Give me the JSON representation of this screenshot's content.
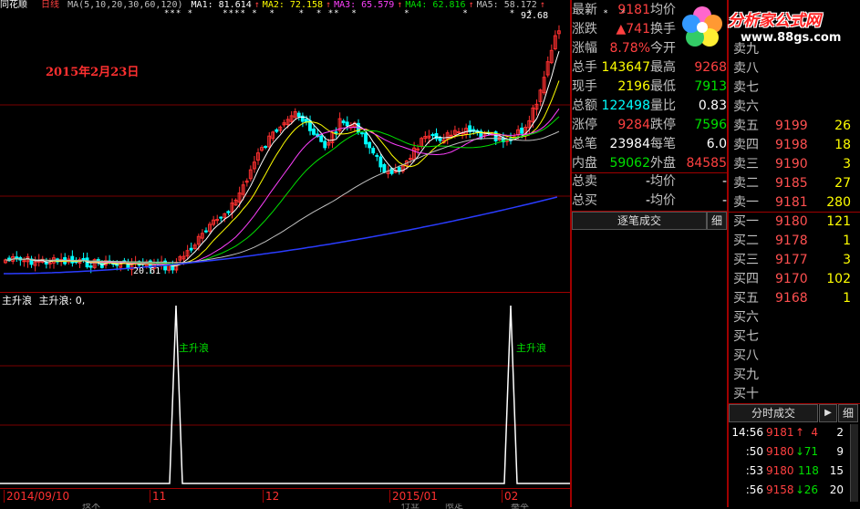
{
  "header": {
    "app_name": "同花顺",
    "period": "日线",
    "ma_params": "MA(5,10,20,30,60,120)",
    "ma": [
      {
        "label": "MA1:",
        "value": "81.614",
        "arrow": "↑",
        "color": "#ffffff"
      },
      {
        "label": "MA2:",
        "value": "72.158",
        "arrow": "↑",
        "color": "#ffff00"
      },
      {
        "label": "MA3:",
        "value": "65.579",
        "arrow": "↑",
        "color": "#ff40ff"
      },
      {
        "label": "MA4:",
        "value": "62.816",
        "arrow": "↑",
        "color": "#00e000"
      },
      {
        "label": "MA5:",
        "value": "58.172",
        "arrow": "↑",
        "color": "#c0c0c0"
      }
    ],
    "max_price_label": "92.68"
  },
  "chart": {
    "date_annotation": "2015年2月23日",
    "min_price_label": "20.61",
    "indicator_title": "主升浪",
    "indicator_value": "主升浪: 0,",
    "signal_label": "主升浪",
    "x_axis_labels": [
      "2014/09/10",
      "11",
      "12",
      "2015/01",
      "02"
    ],
    "bottom_tabs": [
      "技术",
      "行业",
      "限定",
      "基本"
    ]
  },
  "chart_data": {
    "type": "candlestick",
    "title": "",
    "xlabel": "",
    "ylabel": "",
    "x_axis_ticks": [
      "2014/09/10",
      "11",
      "12",
      "2015/01",
      "02"
    ],
    "price_labels": {
      "max": 92.68,
      "min": 20.61
    },
    "ma_series": [
      {
        "name": "MA1",
        "last": 81.614
      },
      {
        "name": "MA2",
        "last": 72.158
      },
      {
        "name": "MA3",
        "last": 65.579
      },
      {
        "name": "MA4",
        "last": 62.816
      },
      {
        "name": "MA5",
        "last": 58.172
      }
    ],
    "indicator": {
      "name": "主升浪",
      "current": 0,
      "signals_at": [
        "11",
        "02"
      ]
    }
  },
  "quote": {
    "rows": [
      {
        "l1": "最新",
        "v1": "9181",
        "v1c": "#ff4040",
        "l2": "均价",
        "v2": "",
        "v2c": "#ffffff"
      },
      {
        "l1": "涨跌",
        "v1": "▲741",
        "v1c": "#ff4040",
        "l2": "换手",
        "v2": "",
        "v2c": "#ffffff"
      },
      {
        "l1": "涨幅",
        "v1": "8.78%",
        "v1c": "#ff4040",
        "l2": "今开",
        "v2": "",
        "v2c": "#ffffff"
      },
      {
        "l1": "总手",
        "v1": "143647",
        "v1c": "#ffff00",
        "l2": "最高",
        "v2": "9268",
        "v2c": "#ff4040"
      },
      {
        "l1": "现手",
        "v1": "2196",
        "v1c": "#ffff00",
        "l2": "最低",
        "v2": "7913",
        "v2c": "#00e000"
      },
      {
        "l1": "总额",
        "v1": "122498",
        "v1c": "#00ffff",
        "l2": "量比",
        "v2": "0.83",
        "v2c": "#ffffff"
      },
      {
        "l1": "涨停",
        "v1": "9284",
        "v1c": "#ff4040",
        "l2": "跌停",
        "v2": "7596",
        "v2c": "#00e000"
      },
      {
        "l1": "总笔",
        "v1": "23984",
        "v1c": "#ffffff",
        "l2": "每笔",
        "v2": "6.0",
        "v2c": "#ffffff"
      },
      {
        "l1": "内盘",
        "v1": "59062",
        "v1c": "#00e000",
        "l2": "外盘",
        "v2": "84585",
        "v2c": "#ff4040"
      },
      {
        "l1": "总卖",
        "v1": "-",
        "v1c": "#ffffff",
        "l2": "均价",
        "v2": "-",
        "v2c": "#ffffff"
      },
      {
        "l1": "总买",
        "v1": "-",
        "v1c": "#ffffff",
        "l2": "均价",
        "v2": "-",
        "v2c": "#ffffff"
      }
    ],
    "trade_detail_tab": "逐笔成交",
    "detail_tab": "细"
  },
  "order_book": {
    "asks_partial": [
      "卖九",
      "卖八",
      "卖七",
      "卖六"
    ],
    "asks": [
      {
        "label": "卖五",
        "price": "9199",
        "vol": "26"
      },
      {
        "label": "卖四",
        "price": "9198",
        "vol": "18"
      },
      {
        "label": "卖三",
        "price": "9190",
        "vol": "3"
      },
      {
        "label": "卖二",
        "price": "9185",
        "vol": "27"
      },
      {
        "label": "卖一",
        "price": "9181",
        "vol": "280"
      }
    ],
    "bids": [
      {
        "label": "买一",
        "price": "9180",
        "vol": "121"
      },
      {
        "label": "买二",
        "price": "9178",
        "vol": "1"
      },
      {
        "label": "买三",
        "price": "9177",
        "vol": "3"
      },
      {
        "label": "买四",
        "price": "9170",
        "vol": "102"
      },
      {
        "label": "买五",
        "price": "9168",
        "vol": "1"
      }
    ],
    "bids_empty": [
      "买六",
      "买七",
      "买八",
      "买九",
      "买十"
    ]
  },
  "ticks": {
    "tab_label": "分时成交",
    "detail_tab": "细",
    "rows": [
      {
        "time": "14:56",
        "price": "9181",
        "arrow": "↑",
        "arrow_color": "#ff4040",
        "vol": "4",
        "n": "2"
      },
      {
        "time": ":50",
        "price": "9180",
        "arrow": "↓",
        "arrow_color": "#00e000",
        "vol": "71",
        "n": "9"
      },
      {
        "time": ":53",
        "price": "9180",
        "arrow": "",
        "arrow_color": "#00e000",
        "vol": "118",
        "n": "15"
      },
      {
        "time": ":56",
        "price": "9158",
        "arrow": "↓",
        "arrow_color": "#00e000",
        "vol": "26",
        "n": "20"
      }
    ]
  },
  "watermark": {
    "site": "分析家公式网",
    "url": "www.88gs.com"
  }
}
